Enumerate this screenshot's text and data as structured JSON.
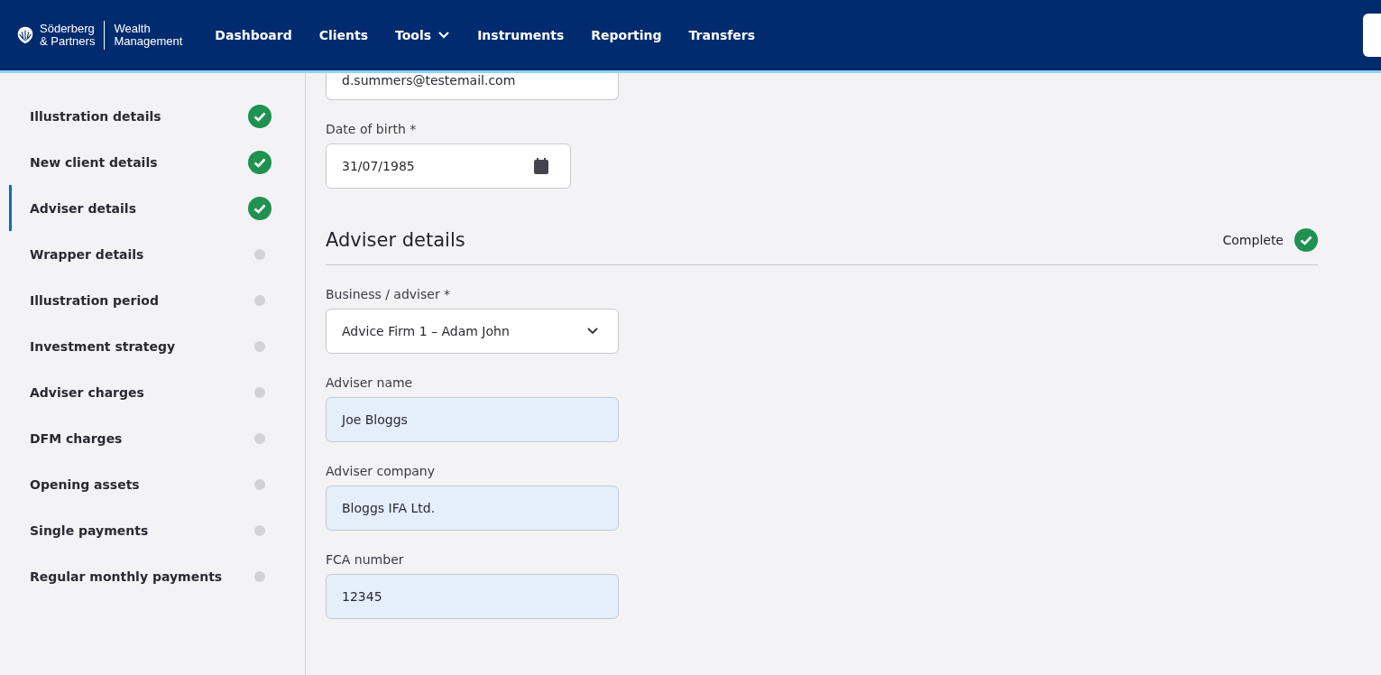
{
  "brand": {
    "name_line1": "Söderberg",
    "name_line2": "& Partners",
    "product_line1": "Wealth",
    "product_line2": "Management"
  },
  "nav": [
    {
      "label": "Dashboard",
      "has_menu": false
    },
    {
      "label": "Clients",
      "has_menu": false
    },
    {
      "label": "Tools",
      "has_menu": true
    },
    {
      "label": "Instruments",
      "has_menu": false
    },
    {
      "label": "Reporting",
      "has_menu": false
    },
    {
      "label": "Transfers",
      "has_menu": false
    }
  ],
  "steps": [
    {
      "label": "Illustration details",
      "complete": true,
      "selected": false
    },
    {
      "label": "New client details",
      "complete": true,
      "selected": false
    },
    {
      "label": "Adviser details",
      "complete": true,
      "selected": true
    },
    {
      "label": "Wrapper details",
      "complete": false,
      "selected": false
    },
    {
      "label": "Illustration period",
      "complete": false,
      "selected": false
    },
    {
      "label": "Investment strategy",
      "complete": false,
      "selected": false
    },
    {
      "label": "Adviser charges",
      "complete": false,
      "selected": false
    },
    {
      "label": "DFM charges",
      "complete": false,
      "selected": false
    },
    {
      "label": "Opening assets",
      "complete": false,
      "selected": false
    },
    {
      "label": "Single payments",
      "complete": false,
      "selected": false
    },
    {
      "label": "Regular monthly payments",
      "complete": false,
      "selected": false
    }
  ],
  "client_fields": [
    {
      "kind": "text",
      "value": "d.summers@testemail.com",
      "autofilled": false
    },
    {
      "kind": "date",
      "label": "Date of birth *",
      "value": "31/07/1985",
      "autofilled": false
    }
  ],
  "section": {
    "title": "Adviser details",
    "status": "Complete",
    "complete": true
  },
  "adviser_fields": [
    {
      "kind": "select",
      "label": "Business / adviser *",
      "value": "Advice Firm 1 – Adam John",
      "autofilled": false
    },
    {
      "kind": "text",
      "label": "Adviser name",
      "value": "Joe Bloggs",
      "autofilled": true
    },
    {
      "kind": "text",
      "label": "Adviser company",
      "value": "Bloggs IFA Ltd.",
      "autofilled": true
    },
    {
      "kind": "text",
      "label": "FCA number",
      "value": "12345",
      "autofilled": true
    }
  ]
}
